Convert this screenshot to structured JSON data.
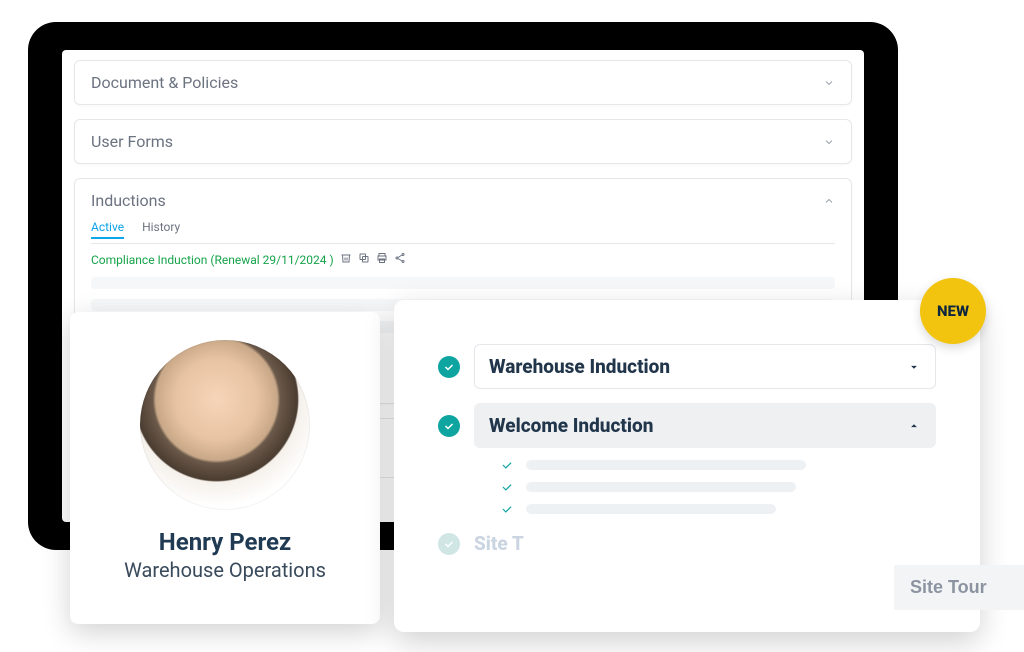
{
  "accordions": {
    "documents": {
      "title": "Document & Policies"
    },
    "userforms": {
      "title": "User Forms"
    },
    "inductions": {
      "title": "Inductions",
      "tabs": {
        "active": "Active",
        "history": "History"
      },
      "compliance_label": "Compliance Induction (Renewal 29/11/2024 )"
    }
  },
  "profile": {
    "name": "Henry Perez",
    "role": "Warehouse Operations"
  },
  "induction_panel": {
    "badge": "NEW",
    "items": [
      {
        "title": "Warehouse Induction"
      },
      {
        "title": "Welcome Induction"
      },
      {
        "title_partial": "Site T"
      }
    ],
    "add_placeholder": "Site Tour"
  },
  "colors": {
    "accent_teal": "#0ea5a1",
    "badge_yellow": "#f2c40f",
    "add_green": "#93c64a",
    "tab_active": "#0ea5e9",
    "text_dark": "#21354b"
  }
}
